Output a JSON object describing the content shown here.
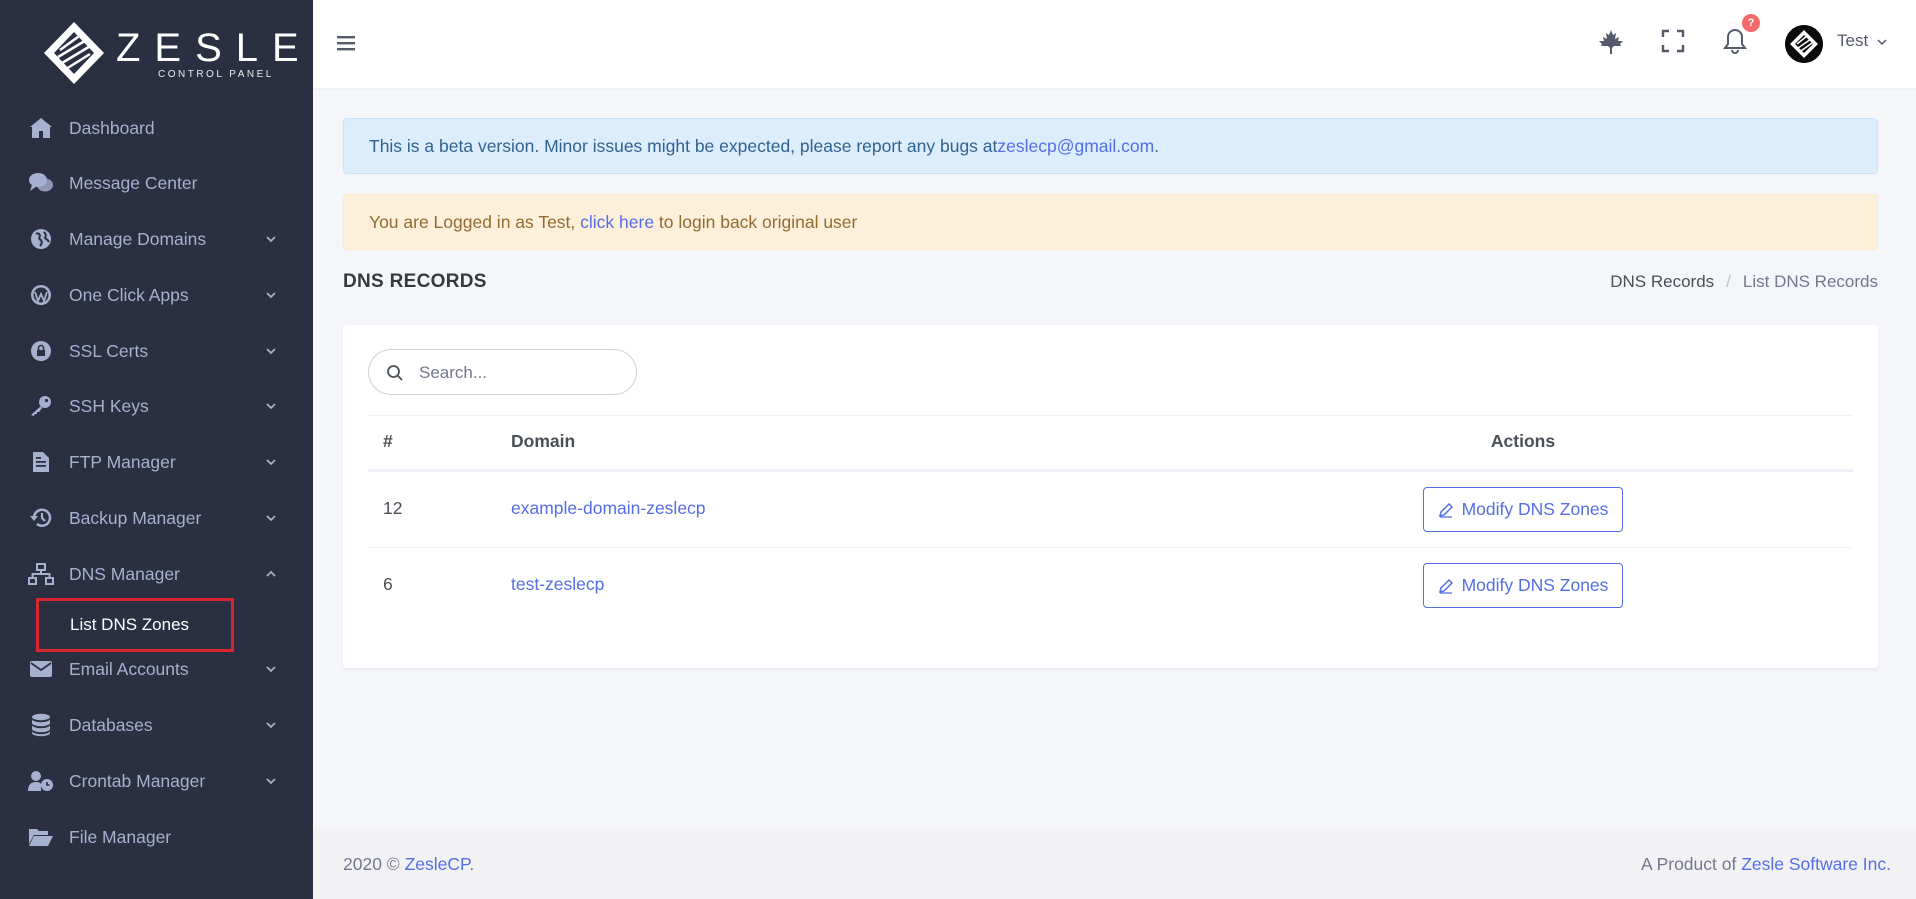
{
  "brand": {
    "name": "ZESLE",
    "tagline": "CONTROL PANEL"
  },
  "sidebar": {
    "items": [
      {
        "label": "Dashboard",
        "icon": "home-icon",
        "has_chevron": false
      },
      {
        "label": "Message Center",
        "icon": "comments-icon",
        "has_chevron": false
      },
      {
        "label": "Manage Domains",
        "icon": "globe-icon",
        "has_chevron": true
      },
      {
        "label": "One Click Apps",
        "icon": "wordpress-icon",
        "has_chevron": true
      },
      {
        "label": "SSL Certs",
        "icon": "lock-icon",
        "has_chevron": true
      },
      {
        "label": "SSH Keys",
        "icon": "key-icon",
        "has_chevron": true
      },
      {
        "label": "FTP Manager",
        "icon": "file-icon",
        "has_chevron": true
      },
      {
        "label": "Backup Manager",
        "icon": "history-icon",
        "has_chevron": true
      },
      {
        "label": "DNS Manager",
        "icon": "sitemap-icon",
        "has_chevron": true,
        "expanded": true
      },
      {
        "label": "Email Accounts",
        "icon": "envelope-icon",
        "has_chevron": true
      },
      {
        "label": "Databases",
        "icon": "database-icon",
        "has_chevron": true
      },
      {
        "label": "Crontab Manager",
        "icon": "user-clock-icon",
        "has_chevron": true
      },
      {
        "label": "File Manager",
        "icon": "folder-open-icon",
        "has_chevron": false
      }
    ],
    "submenu": {
      "label": "List DNS Zones"
    }
  },
  "topbar": {
    "notification_count": "?",
    "user_name": "Test"
  },
  "alerts": {
    "beta_text": "This is a beta version. Minor issues might be expected, please report any bugs at ",
    "beta_email": "zeslecp@gmail.com",
    "beta_end": ".",
    "login_prefix": "You are Logged in as Test, ",
    "login_link": "click here",
    "login_suffix": " to login back original user"
  },
  "page": {
    "title": "DNS RECORDS",
    "breadcrumb": [
      "DNS Records",
      "List DNS Records"
    ]
  },
  "search": {
    "placeholder": "Search..."
  },
  "table": {
    "headers": [
      "#",
      "Domain",
      "Actions"
    ],
    "rows": [
      {
        "id": "12",
        "domain": "example-domain-zeslecp",
        "action": "Modify DNS Zones"
      },
      {
        "id": "6",
        "domain": "test-zeslecp",
        "action": "Modify DNS Zones"
      }
    ]
  },
  "footer": {
    "year_text": "2020 © ",
    "brand_link": "ZesleCP",
    "brand_end": ".",
    "product_text": "A Product of ",
    "company_link": "Zesle Software Inc."
  },
  "colors": {
    "sidebar_bg": "#2a3042",
    "sidebar_text": "#a6b0cf",
    "accent": "#556ee6",
    "highlight_border": "#d7262e",
    "badge": "#f46a6a"
  }
}
